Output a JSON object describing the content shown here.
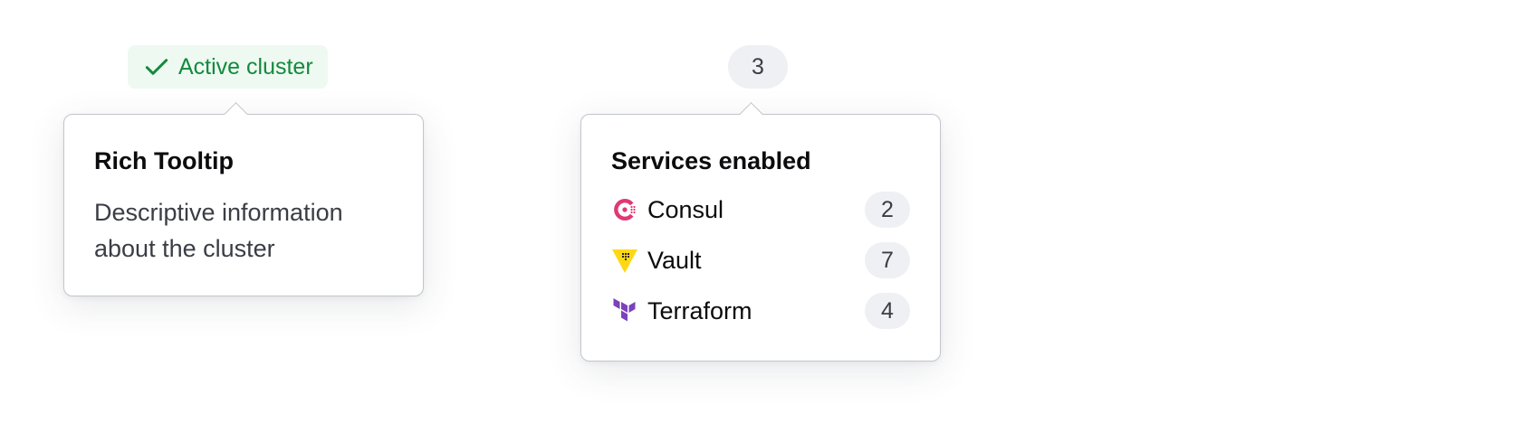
{
  "status_badge": {
    "label": "Active cluster",
    "icon": "check-icon",
    "color": "#138a3e",
    "background": "#eef9f1"
  },
  "count_badge": {
    "label": "3"
  },
  "rich_tooltip": {
    "title": "Rich Tooltip",
    "body": "Descriptive information about the cluster"
  },
  "services_tooltip": {
    "title": "Services enabled",
    "items": [
      {
        "name": "Consul",
        "count": "2",
        "icon": "consul-logo-icon",
        "color": "#e03875"
      },
      {
        "name": "Vault",
        "count": "7",
        "icon": "vault-logo-icon",
        "color": "#ffd814"
      },
      {
        "name": "Terraform",
        "count": "4",
        "icon": "terraform-logo-icon",
        "color": "#7b42bc"
      }
    ]
  }
}
